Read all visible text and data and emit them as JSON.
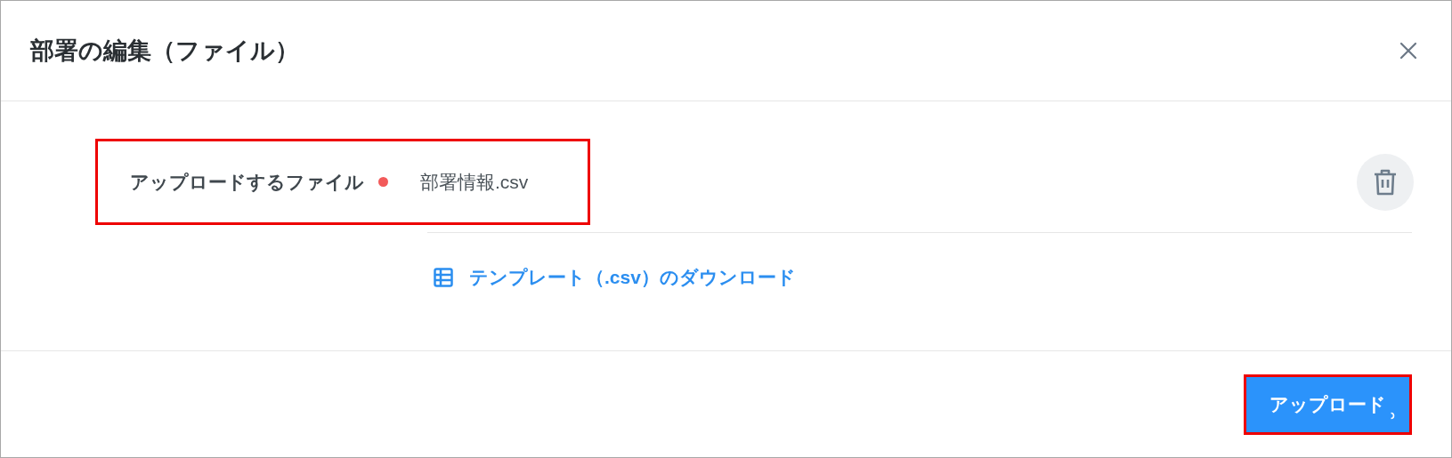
{
  "dialog": {
    "title": "部署の編集（ファイル）"
  },
  "file_field": {
    "label": "アップロードするファイル",
    "required": true,
    "value": "部署情報.csv",
    "highlighted": true
  },
  "template_link": {
    "label": "テンプレート（.csv）のダウンロード"
  },
  "upload_button": {
    "label": "アップロード",
    "highlighted": true,
    "loading": true
  }
}
